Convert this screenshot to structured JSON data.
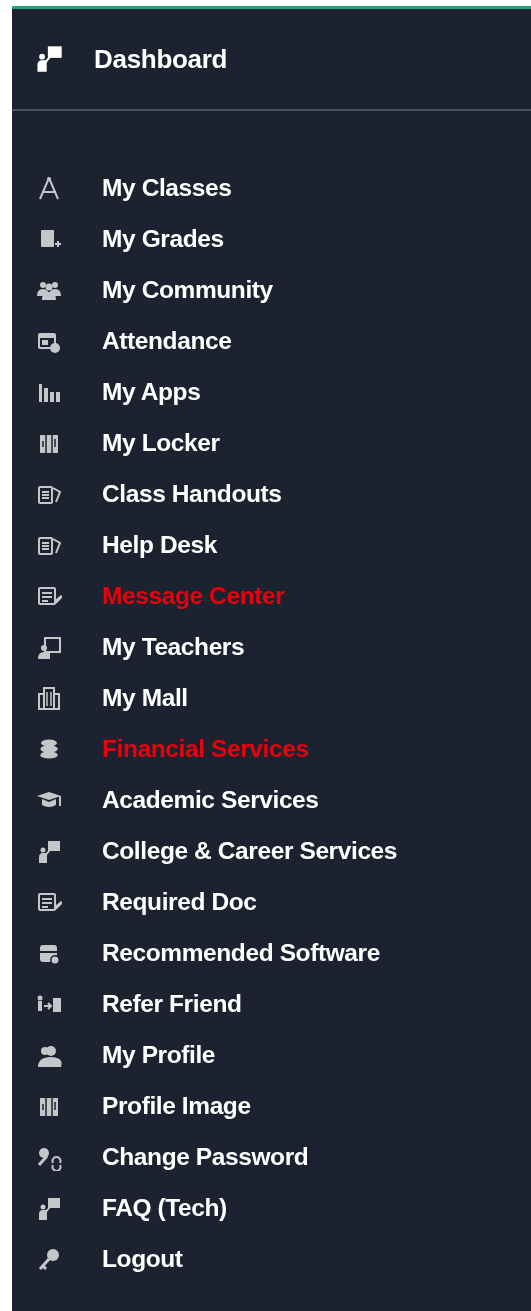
{
  "header": {
    "label": "Dashboard"
  },
  "menu": [
    {
      "label": "My Classes",
      "color": "#ffffff"
    },
    {
      "label": "My Grades",
      "color": "#ffffff"
    },
    {
      "label": "My Community",
      "color": "#ffffff"
    },
    {
      "label": "Attendance",
      "color": "#ffffff"
    },
    {
      "label": "My Apps",
      "color": "#ffffff"
    },
    {
      "label": "My Locker",
      "color": "#ffffff"
    },
    {
      "label": "Class Handouts",
      "color": "#ffffff"
    },
    {
      "label": "Help Desk",
      "color": "#ffffff"
    },
    {
      "label": "Message Center",
      "color": "#e8000b"
    },
    {
      "label": "My Teachers",
      "color": "#ffffff"
    },
    {
      "label": "My Mall",
      "color": "#ffffff"
    },
    {
      "label": "Financial Services",
      "color": "#e8000b"
    },
    {
      "label": "Academic Services",
      "color": "#ffffff"
    },
    {
      "label": "College & Career Services",
      "color": "#ffffff"
    },
    {
      "label": "Required Doc",
      "color": "#ffffff"
    },
    {
      "label": "Recommended Software",
      "color": "#ffffff"
    },
    {
      "label": "Refer Friend",
      "color": "#ffffff"
    },
    {
      "label": "My Profile",
      "color": "#ffffff"
    },
    {
      "label": "Profile Image",
      "color": "#ffffff"
    },
    {
      "label": "Change Password",
      "color": "#ffffff"
    },
    {
      "label": "FAQ (Tech)",
      "color": "#ffffff"
    },
    {
      "label": "Logout",
      "color": "#ffffff"
    }
  ]
}
